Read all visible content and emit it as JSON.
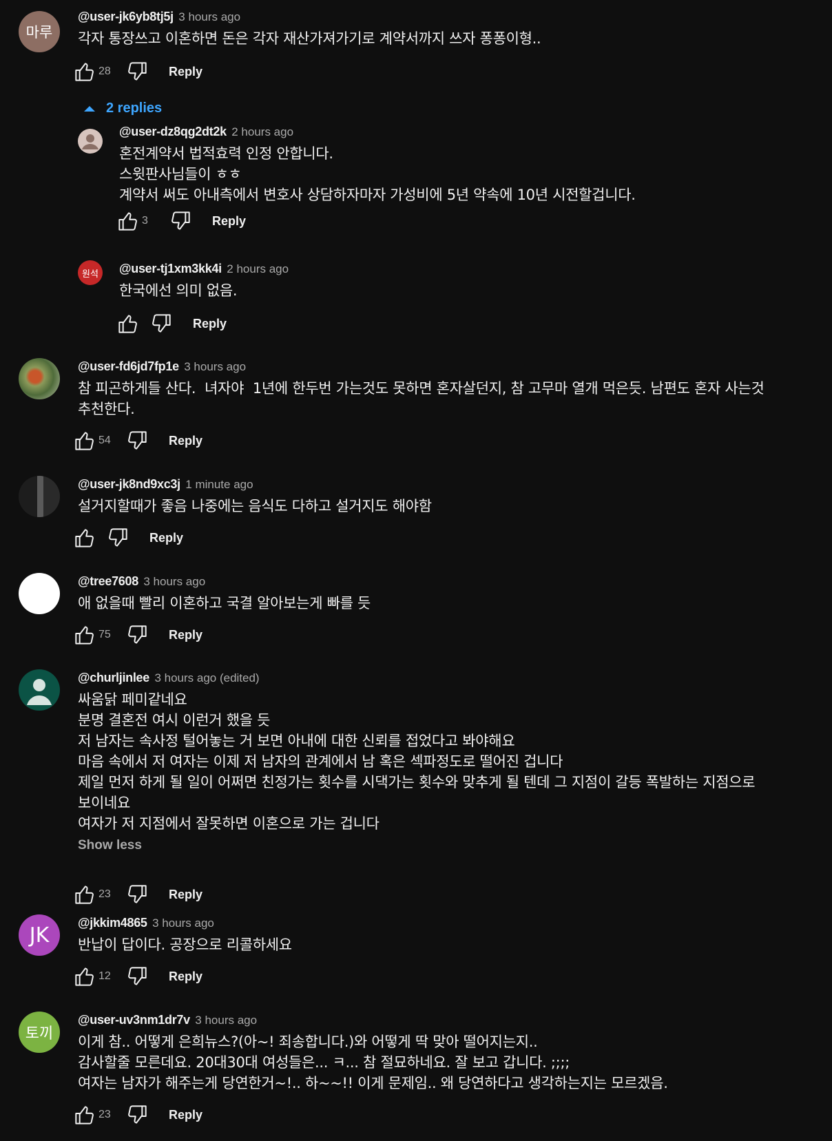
{
  "ui": {
    "reply_label": "Reply",
    "show_less": "Show less",
    "replies_toggle": "2 replies"
  },
  "comments": [
    {
      "author": "@user-jk6yb8tj5j",
      "time": "3 hours ago",
      "avatar_text": "마루",
      "avatar_color": "#8d6e63",
      "text": "각자 통장쓰고 이혼하면 돈은 각자 재산가져가기로 계약서까지 쓰자 퐁퐁이형..",
      "likes": "28"
    },
    {
      "author": "@user-fd6jd7fp1e",
      "time": "3 hours ago",
      "avatar_text": "",
      "avatar_color": "#5d6b4a",
      "text": "참 피곤하게들 산다.  녀자야  1년에 한두번 가는것도 못하면 혼자살던지, 참 고무마 열개 먹은듯. 남편도 혼자 사는것\n추천한다.",
      "likes": "54"
    },
    {
      "author": "@user-jk8nd9xc3j",
      "time": "1 minute ago",
      "avatar_text": "",
      "avatar_color": "#2b2b2b",
      "text": "설거지할때가 좋음 나중에는 음식도 다하고 설거지도 해야함",
      "likes": ""
    },
    {
      "author": "@tree7608",
      "time": "3 hours ago",
      "avatar_text": "",
      "avatar_color": "#ffffff",
      "text": "애 없을때 빨리 이혼하고 국결 알아보는게 빠를 듯",
      "likes": "75"
    },
    {
      "author": "@churljinlee",
      "time": "3 hours ago (edited)",
      "avatar_text": "",
      "avatar_color": "#0b5345",
      "text": "싸움닭 페미같네요\n분명 결혼전 여시 이런거 했을 듯\n저 남자는 속사정 털어놓는 거 보면 아내에 대한 신뢰를 접었다고 봐야해요\n마음 속에서 저 여자는 이제 저 남자의 관계에서 남 혹은 섹파정도로 떨어진 겁니다\n제일 먼저 하게 될 일이 어쩌면 친정가는 횟수를 시댁가는 횟수와 맞추게 될 텐데 그 지점이 갈등 폭발하는 지점으로\n보이네요\n여자가 저 지점에서 잘못하면 이혼으로 가는 겁니다",
      "likes": "23"
    },
    {
      "author": "@jkkim4865",
      "time": "3 hours ago",
      "avatar_text": "JK",
      "avatar_color": "#ab47bc",
      "text": "반납이 답이다. 공장으로 리콜하세요",
      "likes": "12"
    },
    {
      "author": "@user-uv3nm1dr7v",
      "time": "3 hours ago",
      "avatar_text": "토끼",
      "avatar_color": "#7cb342",
      "text": "이게 참.. 어떻게 은희뉴스?(아~! 죄송합니다.)와 어떻게 딱 맞아 떨어지는지..\n감사할줄 모른데요. 20대30대 여성들은... ㅋ... 참 절묘하네요. 잘 보고 갑니다. ;;;;\n여자는 남자가 해주는게 당연한거~!.. 하~~!! 이게 문제임.. 왜 당연하다고 생각하는지는 모르겠음.",
      "likes": "23"
    }
  ],
  "replies": [
    {
      "author": "@user-dz8qg2dt2k",
      "time": "2 hours ago",
      "avatar_text": "",
      "avatar_color": "#d7c4be",
      "text": "혼전계약서 법적효력 인정 안합니다.\n스윗판사님들이 ㅎㅎ\n계약서 써도 아내측에서 변호사 상담하자마자 가성비에 5년 약속에 10년 시전할겁니다.",
      "likes": "3"
    },
    {
      "author": "@user-tj1xm3kk4i",
      "time": "2 hours ago",
      "avatar_text": "원석",
      "avatar_color": "#c62828",
      "text": "한국에선 의미 없음.",
      "likes": ""
    }
  ]
}
